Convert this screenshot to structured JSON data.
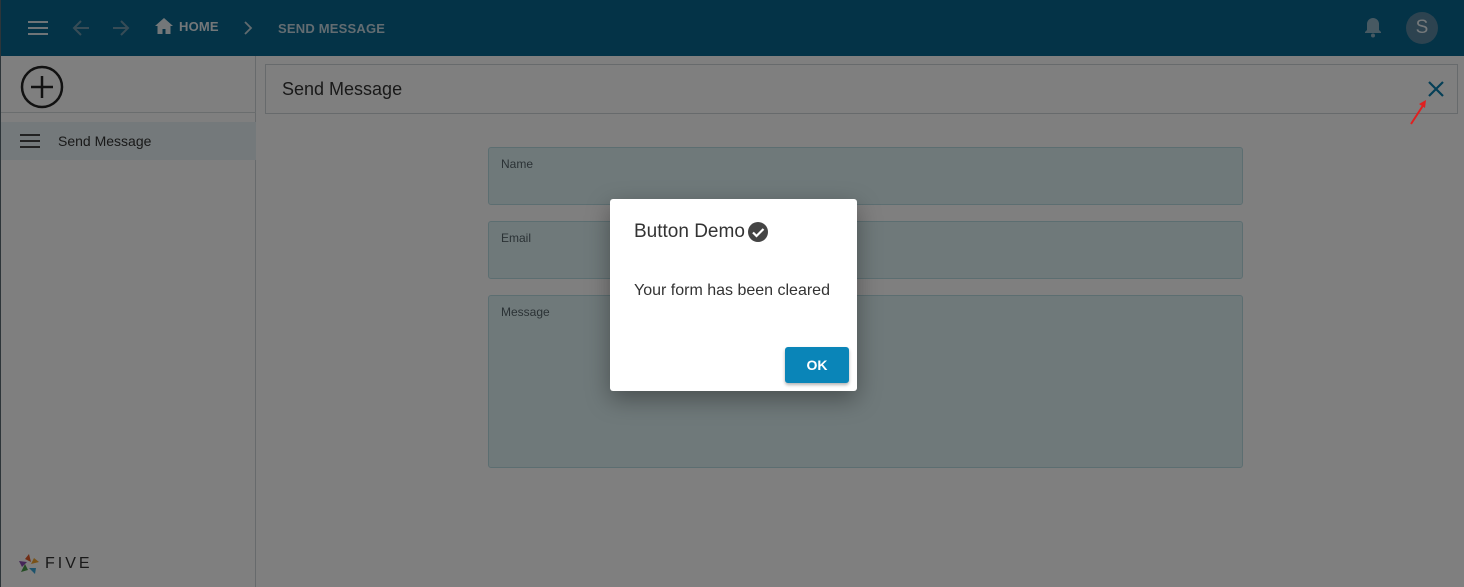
{
  "topbar": {
    "home_label": "HOME",
    "current_label": "SEND MESSAGE",
    "avatar_initial": "S",
    "bg_color": "#08678f"
  },
  "sidebar": {
    "items": [
      {
        "label": "Send Message",
        "icon": "list-icon"
      }
    ],
    "logo_text": "FIVE"
  },
  "main": {
    "title": "Send Message",
    "fields": [
      {
        "label": "Name",
        "value": ""
      },
      {
        "label": "Email",
        "value": ""
      },
      {
        "label": "Message",
        "value": ""
      }
    ]
  },
  "dialog": {
    "title": "Button Demo",
    "message": "Your form has been cleared",
    "ok_label": "OK",
    "button_color": "#0a85b8"
  }
}
